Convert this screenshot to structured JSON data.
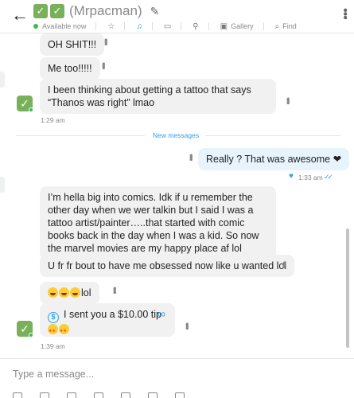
{
  "header": {
    "title_prefix_emojis": [
      "✓",
      "✓"
    ],
    "title": "(Mrpacman)",
    "status": "Available now",
    "gallery_label": "Gallery",
    "find_label": "Find"
  },
  "messages": {
    "m1": "OH SHIT!!!",
    "m2": "Me too!!!!!",
    "m3": "I been thinking about getting a tattoo that says “Thanos was right” lmao",
    "t1": "1:29 am",
    "new_messages": "New messages",
    "out1": "Really ? That was awesome ❤",
    "t_out": "1:33 am",
    "m4": "I’m hella big into comics. Idk if u remember the other day when we wer talkin but I said I was a tattoo artist/painter…..that started with comic books back in the day when I was a kid. So now the marvel movies are my happy place af lol",
    "m5": "U fr fr bout to have me obsessed now like u wanted lol",
    "m6": "lol",
    "tip_text": "I sent you a $10.00 tip",
    "tip_coin": "$",
    "t2": "1:39 am"
  },
  "composer": {
    "placeholder": "Type a message..."
  },
  "icons": [
    "back-arrow-icon",
    "pencil-icon",
    "star-icon",
    "bell-icon",
    "note-icon",
    "pin-icon",
    "gallery-icon",
    "search-icon",
    "more-vertical-icon",
    "heart-icon",
    "read-receipt-icon",
    "dollar-coin-icon",
    "tip-loop-icon"
  ],
  "colors": {
    "accent": "#2aa2e9",
    "online": "#3cba54",
    "incoming_bubble": "#f1f1f1",
    "outgoing_bubble": "#e8f4fc"
  }
}
